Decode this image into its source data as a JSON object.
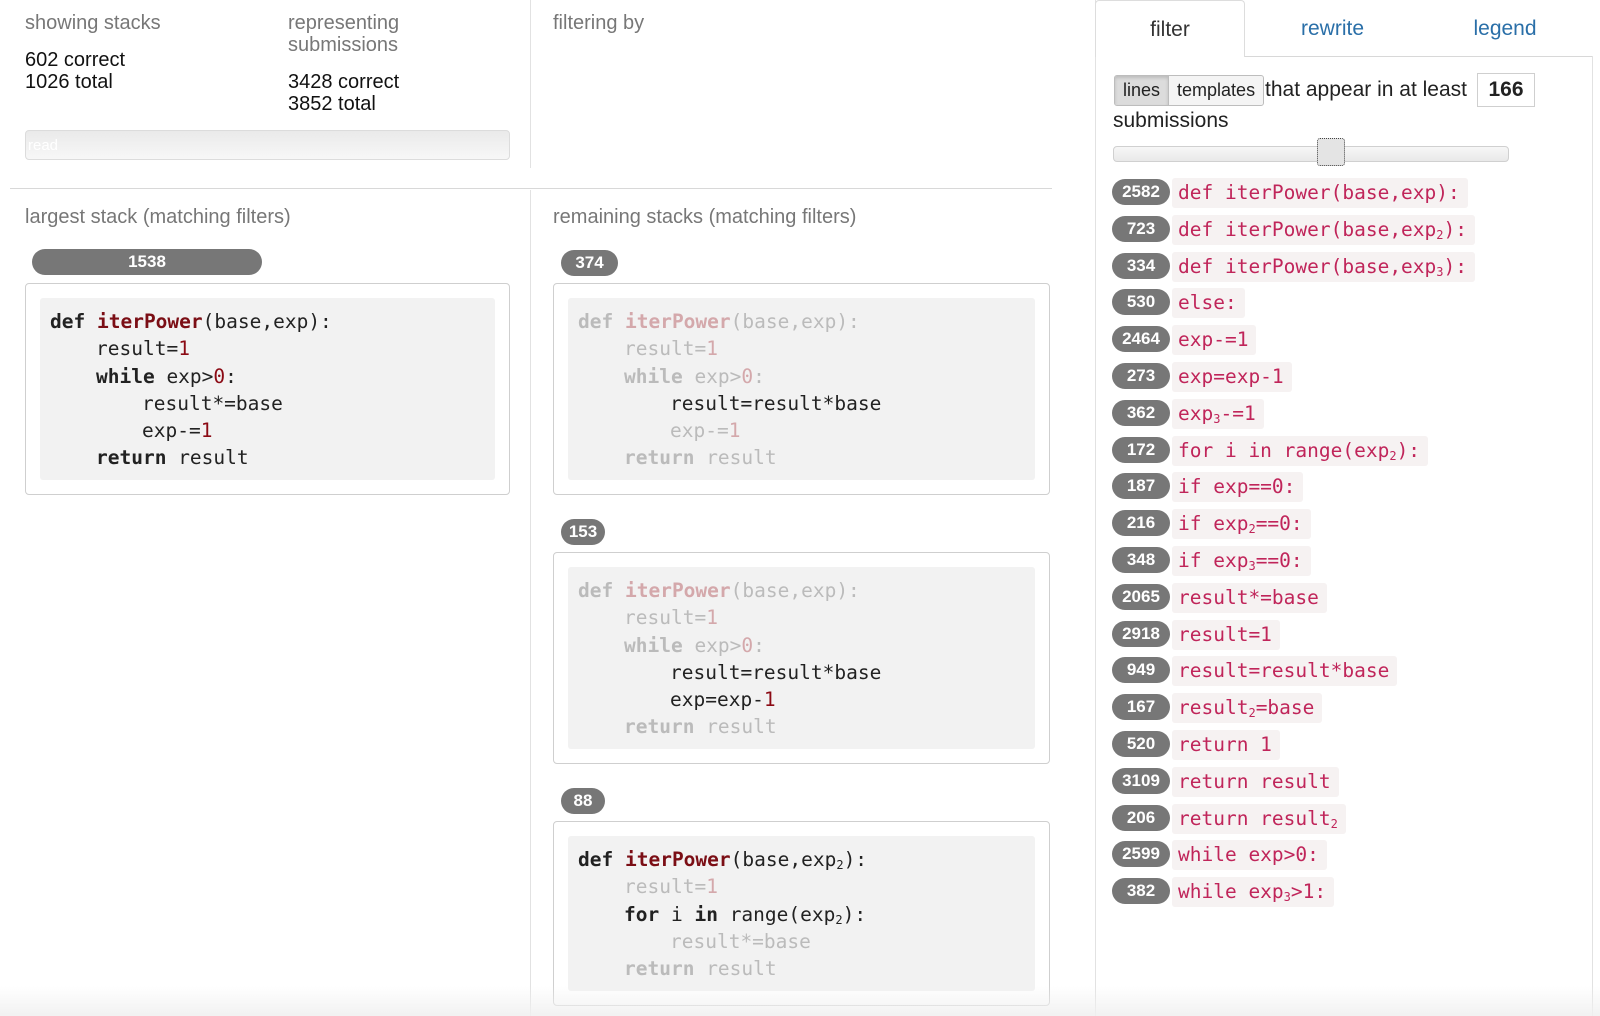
{
  "summary": {
    "showing_label": "showing stacks",
    "showing_correct": "602 correct",
    "showing_total": "1026 total",
    "representing_label_1": "representing",
    "representing_label_2": "submissions",
    "representing_correct": "3428 correct",
    "representing_total": "3852 total",
    "progress_text": "read",
    "filtering_label": "filtering by"
  },
  "largest": {
    "heading": "largest stack (matching filters)",
    "count": "1538",
    "lines": [
      {
        "indent": 0,
        "dim": false,
        "html": "<span class='kw'>def</span> <span class='fn'>iterPower</span>(base,exp):"
      },
      {
        "indent": 1,
        "dim": false,
        "html": "result=<span class='num'>1</span>"
      },
      {
        "indent": 1,
        "dim": false,
        "html": "<span class='kw'>while</span> exp&gt;<span class='num'>0</span>:"
      },
      {
        "indent": 2,
        "dim": false,
        "html": "result*=base"
      },
      {
        "indent": 2,
        "dim": false,
        "html": "exp-=<span class='num'>1</span>"
      },
      {
        "indent": 1,
        "dim": false,
        "html": "<span class='kw'>return</span> result"
      }
    ]
  },
  "remaining": {
    "heading": "remaining stacks (matching filters)",
    "stacks": [
      {
        "count": "374",
        "lines": [
          {
            "indent": 0,
            "dim": true,
            "html": "<span class='kw'>def</span> <span class='fn'>iterPower</span>(base,exp):"
          },
          {
            "indent": 1,
            "dim": true,
            "html": "result=<span class='num'>1</span>"
          },
          {
            "indent": 1,
            "dim": true,
            "html": "<span class='kw'>while</span> exp&gt;<span class='num'>0</span>:"
          },
          {
            "indent": 2,
            "dim": false,
            "html": "result=result*base"
          },
          {
            "indent": 2,
            "dim": true,
            "html": "exp-=<span class='num'>1</span>"
          },
          {
            "indent": 1,
            "dim": true,
            "html": "<span class='kw'>return</span> result"
          }
        ]
      },
      {
        "count": "153",
        "lines": [
          {
            "indent": 0,
            "dim": true,
            "html": "<span class='kw'>def</span> <span class='fn'>iterPower</span>(base,exp):"
          },
          {
            "indent": 1,
            "dim": true,
            "html": "result=<span class='num'>1</span>"
          },
          {
            "indent": 1,
            "dim": true,
            "html": "<span class='kw'>while</span> exp&gt;<span class='num'>0</span>:"
          },
          {
            "indent": 2,
            "dim": false,
            "html": "result=result*base"
          },
          {
            "indent": 2,
            "dim": false,
            "html": "exp=exp-<span class='num'>1</span>"
          },
          {
            "indent": 1,
            "dim": true,
            "html": "<span class='kw'>return</span> result"
          }
        ]
      },
      {
        "count": "88",
        "lines": [
          {
            "indent": 0,
            "dim": false,
            "html": "<span class='kw'>def</span> <span class='fn'>iterPower</span>(base,exp<sub>2</sub>):"
          },
          {
            "indent": 1,
            "dim": true,
            "html": "result=<span class='num'>1</span>"
          },
          {
            "indent": 1,
            "dim": false,
            "html": "<span class='kw'>for</span> i <span class='kw'>in</span> range(exp<sub>2</sub>):"
          },
          {
            "indent": 2,
            "dim": true,
            "html": "result*=base"
          },
          {
            "indent": 1,
            "dim": true,
            "html": "<span class='kw'>return</span> result"
          }
        ]
      }
    ]
  },
  "panel": {
    "tabs": [
      "filter",
      "rewrite",
      "legend"
    ],
    "toggle_lines": "lines",
    "toggle_templates": "templates",
    "appear_text": "that appear in at least",
    "threshold": "166",
    "submissions_text": "submissions",
    "lines": [
      {
        "count": "2582",
        "html": "def iterPower(base,exp):"
      },
      {
        "count": "723",
        "html": "def iterPower(base,exp<sub>2</sub>):"
      },
      {
        "count": "334",
        "html": "def iterPower(base,exp<sub>3</sub>):"
      },
      {
        "count": "530",
        "html": "else:"
      },
      {
        "count": "2464",
        "html": "exp-=1"
      },
      {
        "count": "273",
        "html": "exp=exp-1"
      },
      {
        "count": "362",
        "html": "exp<sub>3</sub>-=1"
      },
      {
        "count": "172",
        "html": "for i in range(exp<sub>2</sub>):"
      },
      {
        "count": "187",
        "html": "if exp==0:"
      },
      {
        "count": "216",
        "html": "if exp<sub>2</sub>==0:"
      },
      {
        "count": "348",
        "html": "if exp<sub>3</sub>==0:"
      },
      {
        "count": "2065",
        "html": "result*=base"
      },
      {
        "count": "2918",
        "html": "result=1"
      },
      {
        "count": "949",
        "html": "result=result*base"
      },
      {
        "count": "167",
        "html": "result<sub>2</sub>=base"
      },
      {
        "count": "520",
        "html": "return 1"
      },
      {
        "count": "3109",
        "html": "return result"
      },
      {
        "count": "206",
        "html": "return result<sub>2</sub>"
      },
      {
        "count": "2599",
        "html": "while exp&gt;0:"
      },
      {
        "count": "382",
        "html": "while exp<sub>3</sub>&gt;1:"
      }
    ]
  }
}
